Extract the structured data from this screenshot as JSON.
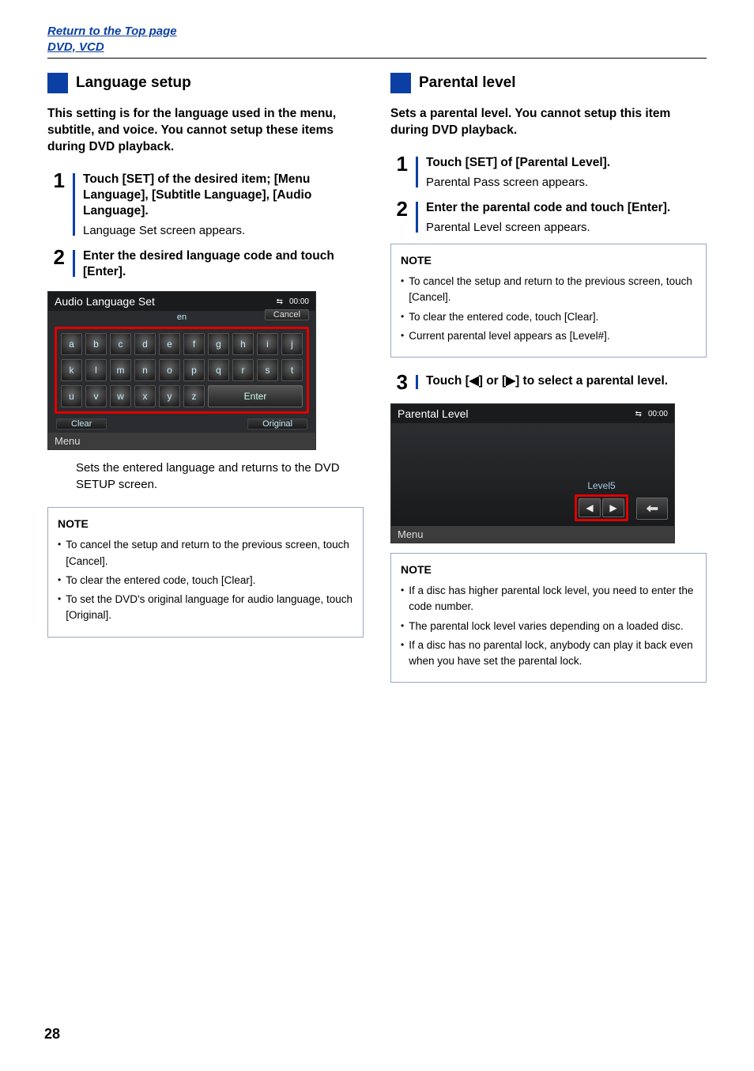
{
  "topLinks": {
    "returnTop": "Return to the Top page",
    "section": "DVD, VCD"
  },
  "left": {
    "title": "Language setup",
    "intro": "This setting is for the language used in the menu, subtitle, and voice. You cannot setup these items during DVD playback.",
    "step1": {
      "bold": "Touch [SET] of the desired item; [Menu Language], [Subtitle Language], [Audio Language].",
      "sub": "Language Set screen appears."
    },
    "step2": {
      "bold": "Enter the desired language code and touch [Enter]."
    },
    "screen1": {
      "title": "Audio Language Set",
      "time": "00:00",
      "lang": "en",
      "cancel": "Cancel",
      "row1": [
        "a",
        "b",
        "c",
        "d",
        "e",
        "f",
        "g",
        "h",
        "i",
        "j"
      ],
      "row2": [
        "k",
        "l",
        "m",
        "n",
        "o",
        "p",
        "q",
        "r",
        "s",
        "t"
      ],
      "row3": [
        "u",
        "v",
        "w",
        "x",
        "y",
        "z"
      ],
      "enter": "Enter",
      "clear": "Clear",
      "original": "Original",
      "menu": "Menu"
    },
    "afterScreen": "Sets the entered language and returns to the DVD SETUP screen.",
    "note": {
      "title": "NOTE",
      "items": [
        "To cancel the setup and return to the previous screen, touch [Cancel].",
        "To clear the entered code, touch [Clear].",
        "To set the DVD's original language for audio language, touch [Original]."
      ]
    }
  },
  "right": {
    "title": "Parental level",
    "intro": "Sets a parental level. You cannot setup this item during DVD playback.",
    "step1": {
      "bold": "Touch [SET] of [Parental Level].",
      "sub": "Parental Pass screen appears."
    },
    "step2": {
      "bold": "Enter the parental code and touch [Enter].",
      "sub": "Parental Level screen appears."
    },
    "note1": {
      "title": "NOTE",
      "items": [
        "To cancel the setup and return to the previous screen, touch [Cancel].",
        "To clear the entered code, touch [Clear].",
        "Current parental level appears as [Level#]."
      ]
    },
    "step3": {
      "bold": "Touch [◀] or [▶] to select a parental level."
    },
    "screen2": {
      "title": "Parental Level",
      "time": "00:00",
      "level": "Level5",
      "menu": "Menu"
    },
    "note2": {
      "title": "NOTE",
      "items": [
        "If a disc has higher parental lock level, you need to enter the code number.",
        "The parental lock level varies depending on a loaded disc.",
        "If a disc has no parental lock, anybody can play it back even when you have set the parental lock."
      ]
    }
  },
  "pageNumber": "28"
}
